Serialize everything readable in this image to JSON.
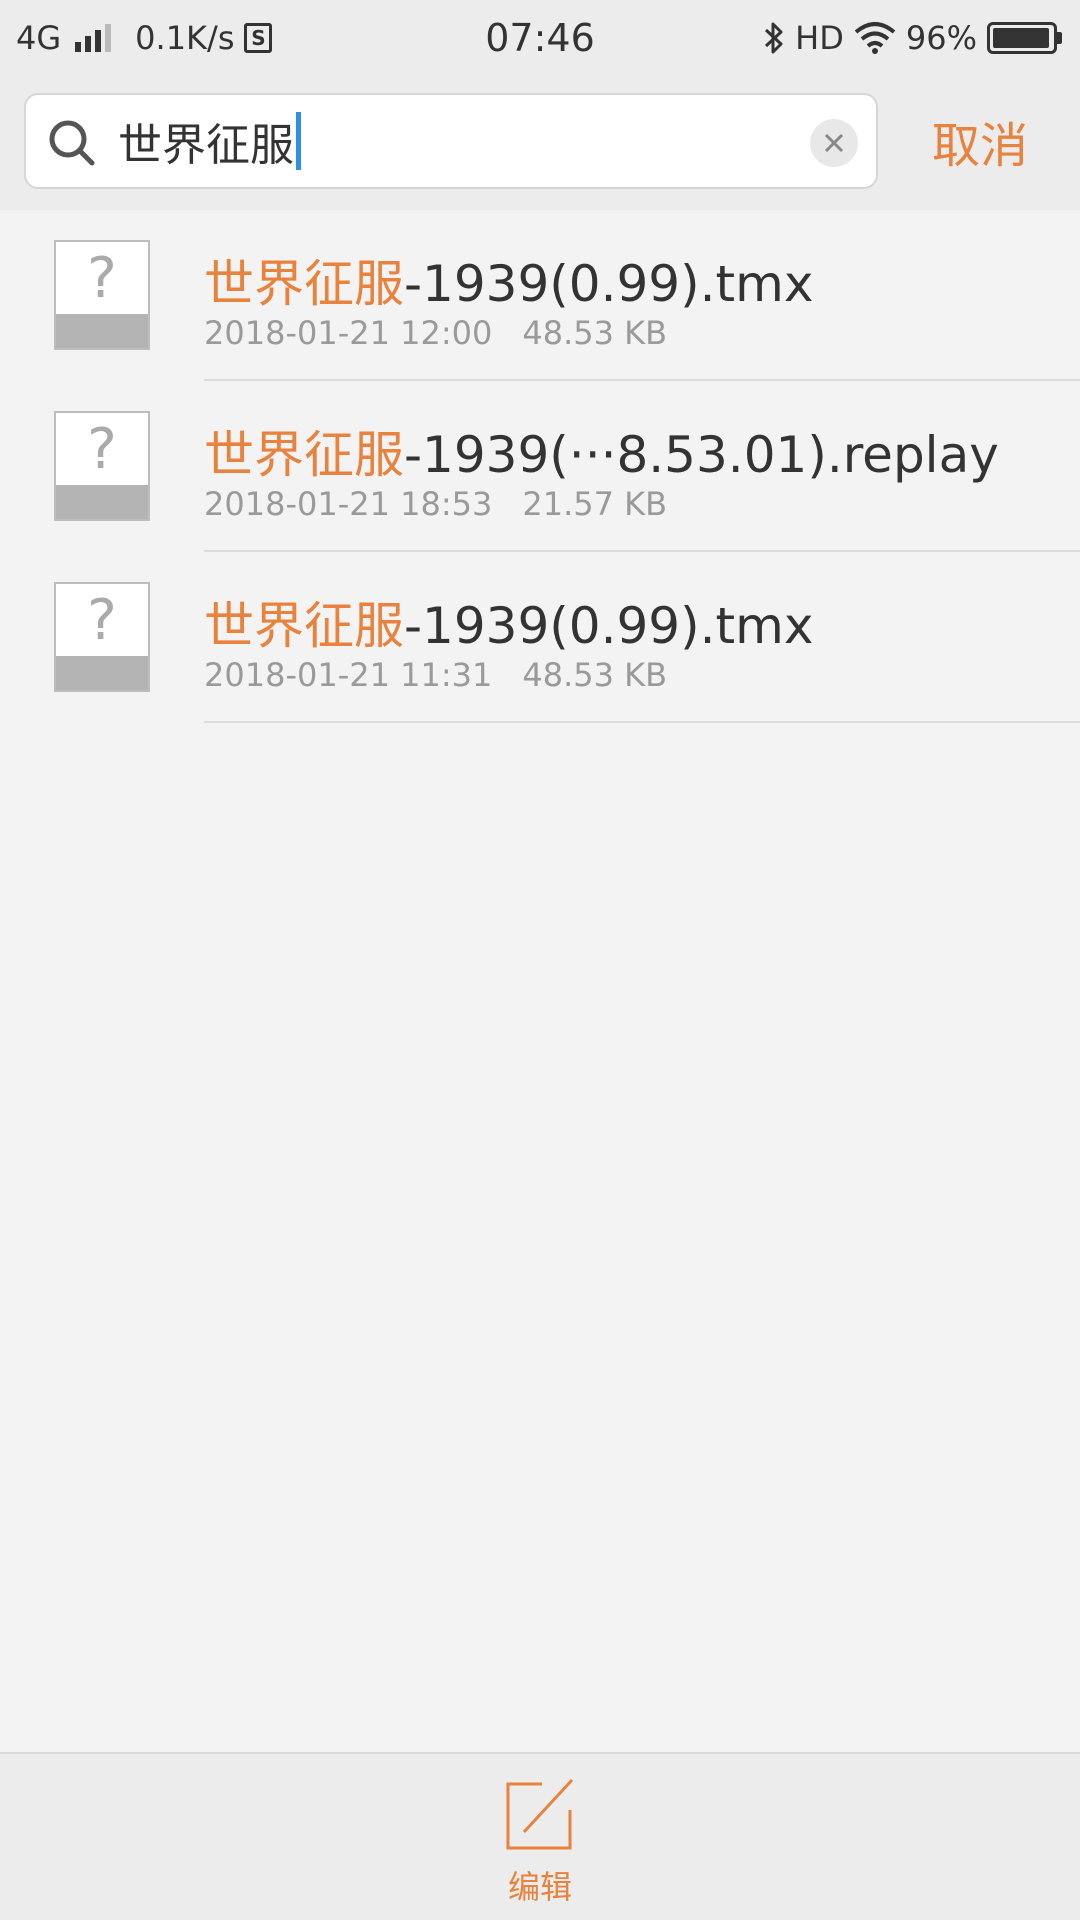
{
  "status_bar": {
    "network": "4G",
    "speed": "0.1K/s",
    "sim_label": "S",
    "time": "07:46",
    "hd": "HD",
    "battery": "96%",
    "battery_level": 0.96,
    "icons": [
      "signal-icon",
      "sim-icon",
      "bluetooth-icon",
      "wifi-icon",
      "battery-icon"
    ]
  },
  "search": {
    "query": "世界征服",
    "cancel_label": "取消",
    "accent_color": "#e8823c",
    "caret_color": "#2d8fe6"
  },
  "files": [
    {
      "name_highlight": "世界征服",
      "name_rest": "-1939(0.99).tmx",
      "date": "2018-01-21 12:00",
      "size": "48.53 KB",
      "icon": "unknown-file-icon"
    },
    {
      "name_highlight": "世界征服",
      "name_rest": "-1939(···8.53.01).replay",
      "date": "2018-01-21 18:53",
      "size": "21.57 KB",
      "icon": "unknown-file-icon"
    },
    {
      "name_highlight": "世界征服",
      "name_rest": "-1939(0.99).tmx",
      "date": "2018-01-21 11:31",
      "size": "48.53 KB",
      "icon": "unknown-file-icon"
    }
  ],
  "file_icon_glyph": "?",
  "bottom_bar": {
    "edit_label": "编辑",
    "icon": "edit-icon"
  }
}
